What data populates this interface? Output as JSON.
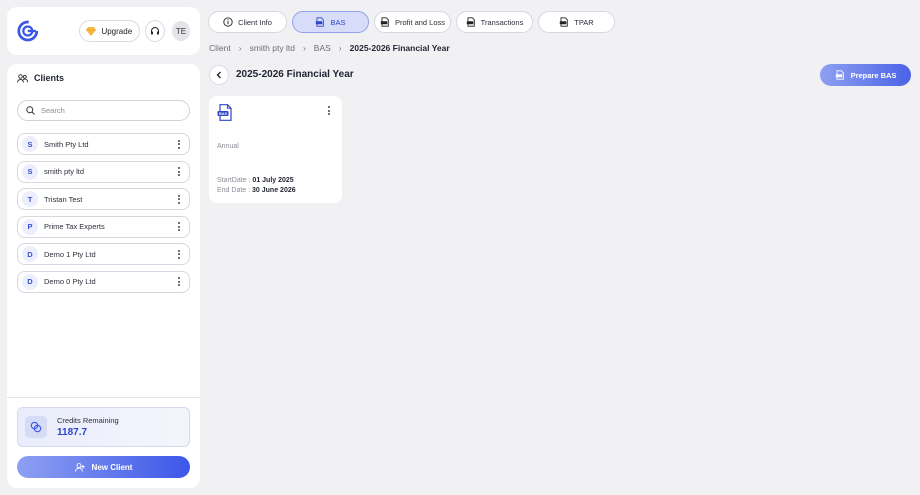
{
  "header": {
    "upgrade_label": "Upgrade",
    "avatar_initials": "TE"
  },
  "sidebar": {
    "title": "Clients",
    "search_placeholder": "Search",
    "clients": [
      {
        "initial": "S",
        "name": "Smith Pty Ltd"
      },
      {
        "initial": "S",
        "name": "smith pty ltd"
      },
      {
        "initial": "T",
        "name": "Tristan Test"
      },
      {
        "initial": "P",
        "name": "Prime Tax Experts"
      },
      {
        "initial": "D",
        "name": "Demo 1 Pty Ltd"
      },
      {
        "initial": "D",
        "name": "Demo 0 Pty Ltd"
      }
    ],
    "credits_label": "Credits Remaining",
    "credits_value": "1187.7",
    "new_client_label": "New Client"
  },
  "tabs": [
    {
      "label": "Client Info",
      "icon": "info-icon",
      "active": false
    },
    {
      "label": "BAS",
      "icon": "document-icon",
      "active": true
    },
    {
      "label": "Profit and Loss",
      "icon": "document-icon",
      "active": false
    },
    {
      "label": "Transactions",
      "icon": "document-icon",
      "active": false
    },
    {
      "label": "TPAR",
      "icon": "document-icon",
      "active": false
    }
  ],
  "breadcrumb": {
    "items": [
      "Client",
      "smith pty ltd",
      "BAS"
    ],
    "current": "2025-2026 Financial Year"
  },
  "page": {
    "title": "2025-2026 Financial Year",
    "prepare_label": "Prepare BAS"
  },
  "bas_card": {
    "badge": "BAS",
    "period": "Annual",
    "start_label": "StartDate :",
    "start_value": "01 July 2025",
    "end_label": "End Date :",
    "end_value": "30 June 2026"
  },
  "colors": {
    "accent": "#3c57e8",
    "accent_light": "#d7ddf8"
  }
}
